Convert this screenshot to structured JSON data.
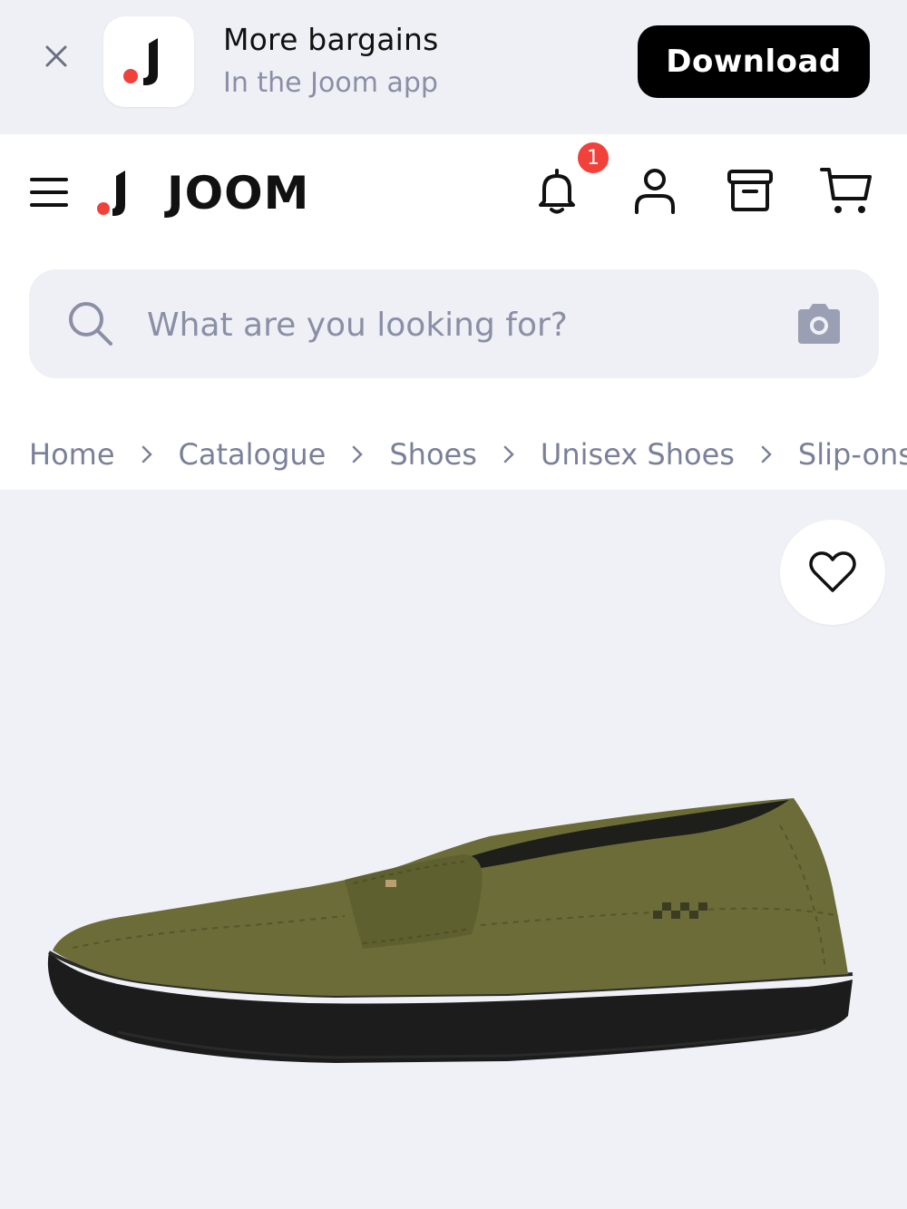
{
  "banner": {
    "title": "More bargains",
    "subtitle": "In the Joom app",
    "download_label": "Download"
  },
  "header": {
    "logo_text": "JOOM",
    "notification_count": "1",
    "icons": [
      "menu-icon",
      "bell-icon",
      "user-icon",
      "box-icon",
      "cart-icon"
    ]
  },
  "search": {
    "placeholder": "What are you looking for?"
  },
  "breadcrumb": [
    "Home",
    "Catalogue",
    "Shoes",
    "Unisex Shoes",
    "Slip-ons"
  ],
  "colors": {
    "brand_red": "#f2413a",
    "banner_bg": "#eef0f5",
    "muted_text": "#8a8fa6",
    "product_bg": "#f0f1f6"
  }
}
